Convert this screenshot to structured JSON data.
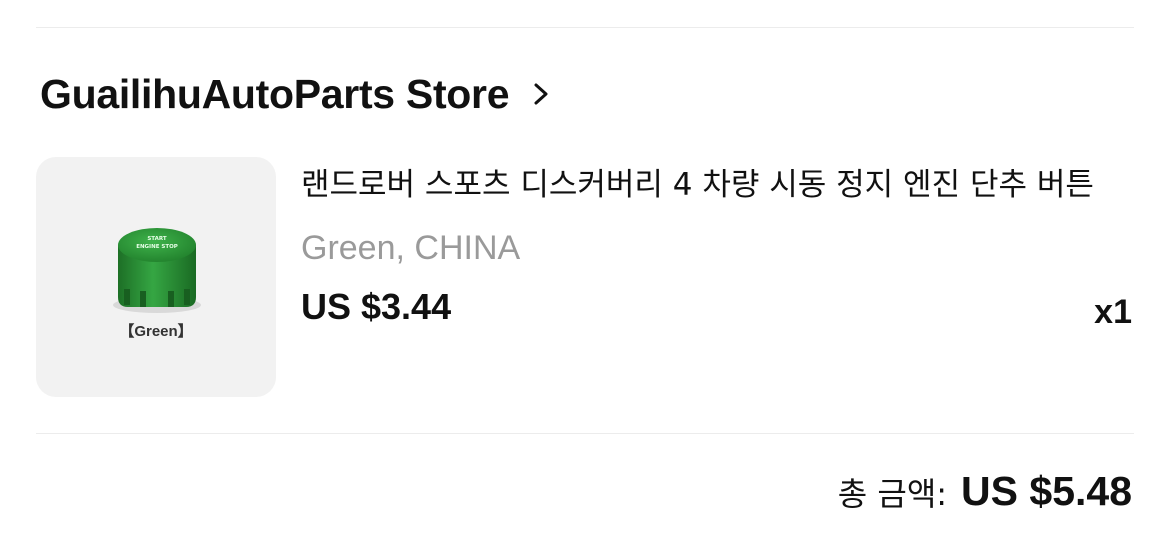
{
  "store": {
    "name": "GuailihuAutoParts Store"
  },
  "product": {
    "image_label": "【Green】",
    "image_text_line1": "START",
    "image_text_line2": "ENGINE STOP",
    "title": "랜드로버 스포츠 디스커버리 4 차량 시동 정지 엔진 단추 버튼",
    "variant": "Green, CHINA",
    "price": "US $3.44",
    "quantity": "x1"
  },
  "total": {
    "label": "총 금액:",
    "value": "US $5.48"
  },
  "colors": {
    "button_green": "#2e9b3a",
    "background_tile": "#f2f2f2",
    "muted_text": "#9a9a9a"
  },
  "icons": {
    "store_chevron": "chevron-right-icon"
  }
}
